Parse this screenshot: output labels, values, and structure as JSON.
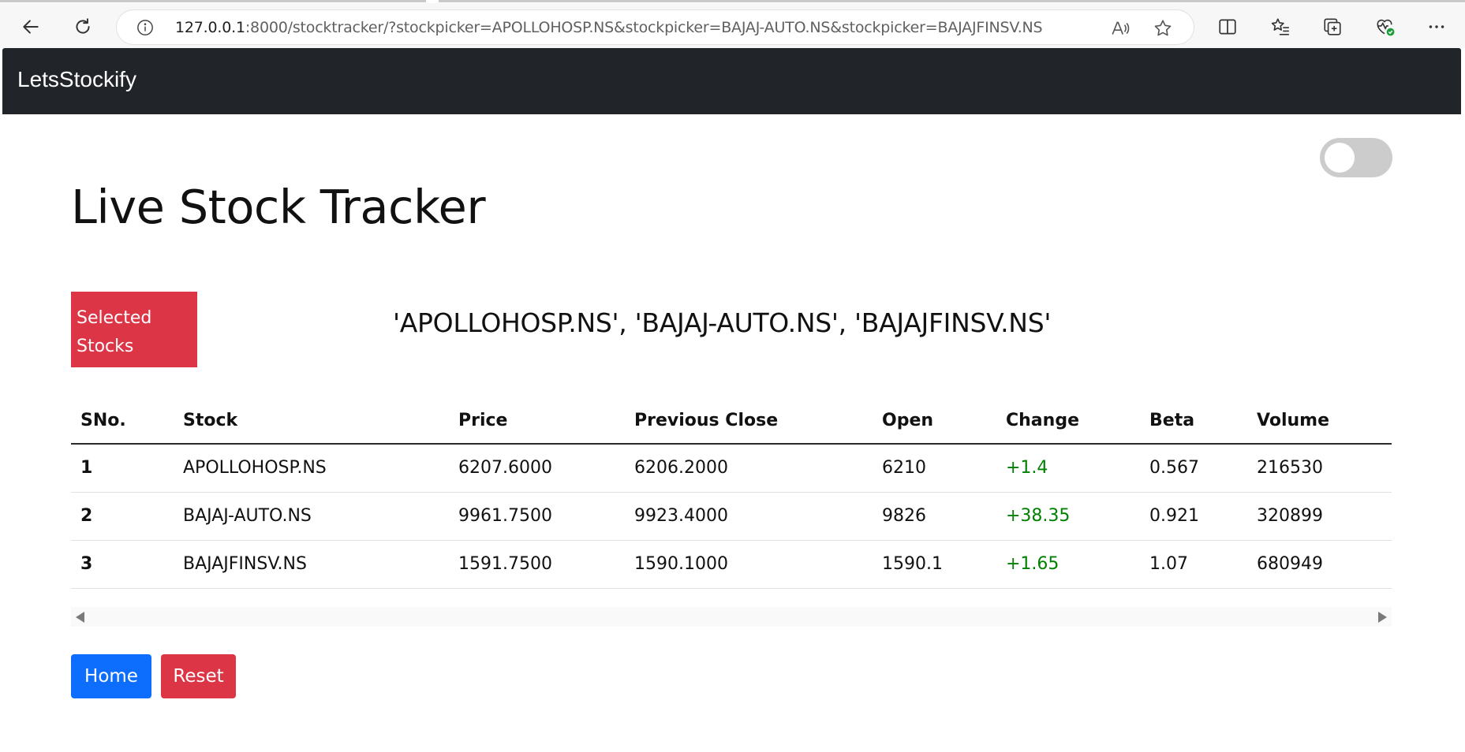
{
  "browser": {
    "url_host": "127.0.0.1",
    "url_rest": ":8000/stocktracker/?stockpicker=APOLLOHOSP.NS&stockpicker=BAJAJ-AUTO.NS&stockpicker=BAJAJFINSV.NS",
    "icons": {
      "back": "back-arrow-icon",
      "reload": "reload-icon",
      "info": "info-icon",
      "read_aloud": "read-aloud-icon",
      "favorite": "star-icon",
      "split": "split-screen-icon",
      "favorites": "favorites-icon",
      "collections": "collections-icon",
      "health": "browser-essentials-icon",
      "more": "more-icon"
    }
  },
  "navbar": {
    "brand": "LetsStockify"
  },
  "page": {
    "title": "Live Stock Tracker",
    "selected_label": "Selected Stocks",
    "selected_stocks": "'APOLLOHOSP.NS', 'BAJAJ-AUTO.NS', 'BAJAJFINSV.NS'"
  },
  "table": {
    "headers": [
      "SNo.",
      "Stock",
      "Price",
      "Previous Close",
      "Open",
      "Change",
      "Beta",
      "Volume"
    ],
    "rows": [
      [
        "1",
        "APOLLOHOSP.NS",
        "6207.6000",
        "6206.2000",
        "6210",
        "+1.4",
        "0.567",
        "216530"
      ],
      [
        "2",
        "BAJAJ-AUTO.NS",
        "9961.7500",
        "9923.4000",
        "9826",
        "+38.35",
        "0.921",
        "320899"
      ],
      [
        "3",
        "BAJAJFINSV.NS",
        "1591.7500",
        "1590.1000",
        "1590.1",
        "+1.65",
        "1.07",
        "680949"
      ]
    ]
  },
  "buttons": {
    "home": "Home",
    "reset": "Reset"
  },
  "colors": {
    "navbar_bg": "#212529",
    "badge_bg": "#dc3545",
    "home_bg": "#0d6efd",
    "reset_bg": "#dc3545",
    "change_positive": "#008000",
    "toggle_bg": "#cccccc"
  }
}
